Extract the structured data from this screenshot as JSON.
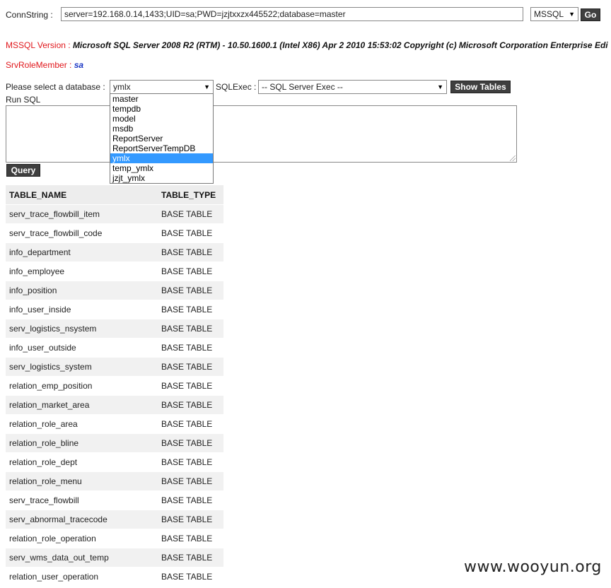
{
  "conn": {
    "label": "ConnString :",
    "value": "server=192.168.0.14,1433;UID=sa;PWD=jzjtxxzx445522;database=master",
    "type_selected": "MSSQL",
    "go_label": "Go"
  },
  "version": {
    "label": "MSSQL Version :",
    "value": "Microsoft SQL Server 2008 R2 (RTM) - 10.50.1600.1 (Intel X86) Apr 2 2010 15:53:02 Copyright (c) Microsoft Corporation Enterprise Edi"
  },
  "role": {
    "label": "SrvRoleMember :",
    "value": "sa"
  },
  "db": {
    "label": "Please select a database :",
    "selected": "ymlx",
    "options": [
      "master",
      "tempdb",
      "model",
      "msdb",
      "ReportServer",
      "ReportServerTempDB",
      "ymlx",
      "temp_ymlx",
      "jzjt_ymlx"
    ],
    "selected_index": 6,
    "sqlexec_label": "SQLExec :",
    "sqlexec_selected": "-- SQL Server Exec --",
    "show_tables_label": "Show Tables"
  },
  "runsql": {
    "label": "Run SQL",
    "value": "",
    "query_label": "Query"
  },
  "table": {
    "headers": [
      "TABLE_NAME",
      "TABLE_TYPE"
    ],
    "rows": [
      [
        "serv_trace_flowbill_item",
        "BASE TABLE"
      ],
      [
        "serv_trace_flowbill_code",
        "BASE TABLE"
      ],
      [
        "info_department",
        "BASE TABLE"
      ],
      [
        "info_employee",
        "BASE TABLE"
      ],
      [
        "info_position",
        "BASE TABLE"
      ],
      [
        "info_user_inside",
        "BASE TABLE"
      ],
      [
        "serv_logistics_nsystem",
        "BASE TABLE"
      ],
      [
        "info_user_outside",
        "BASE TABLE"
      ],
      [
        "serv_logistics_system",
        "BASE TABLE"
      ],
      [
        "relation_emp_position",
        "BASE TABLE"
      ],
      [
        "relation_market_area",
        "BASE TABLE"
      ],
      [
        "relation_role_area",
        "BASE TABLE"
      ],
      [
        "relation_role_bline",
        "BASE TABLE"
      ],
      [
        "relation_role_dept",
        "BASE TABLE"
      ],
      [
        "relation_role_menu",
        "BASE TABLE"
      ],
      [
        "serv_trace_flowbill",
        "BASE TABLE"
      ],
      [
        "serv_abnormal_tracecode",
        "BASE TABLE"
      ],
      [
        "relation_role_operation",
        "BASE TABLE"
      ],
      [
        "serv_wms_data_out_temp",
        "BASE TABLE"
      ],
      [
        "relation_user_operation",
        "BASE TABLE"
      ]
    ]
  },
  "watermark": "www.wooyun.org"
}
